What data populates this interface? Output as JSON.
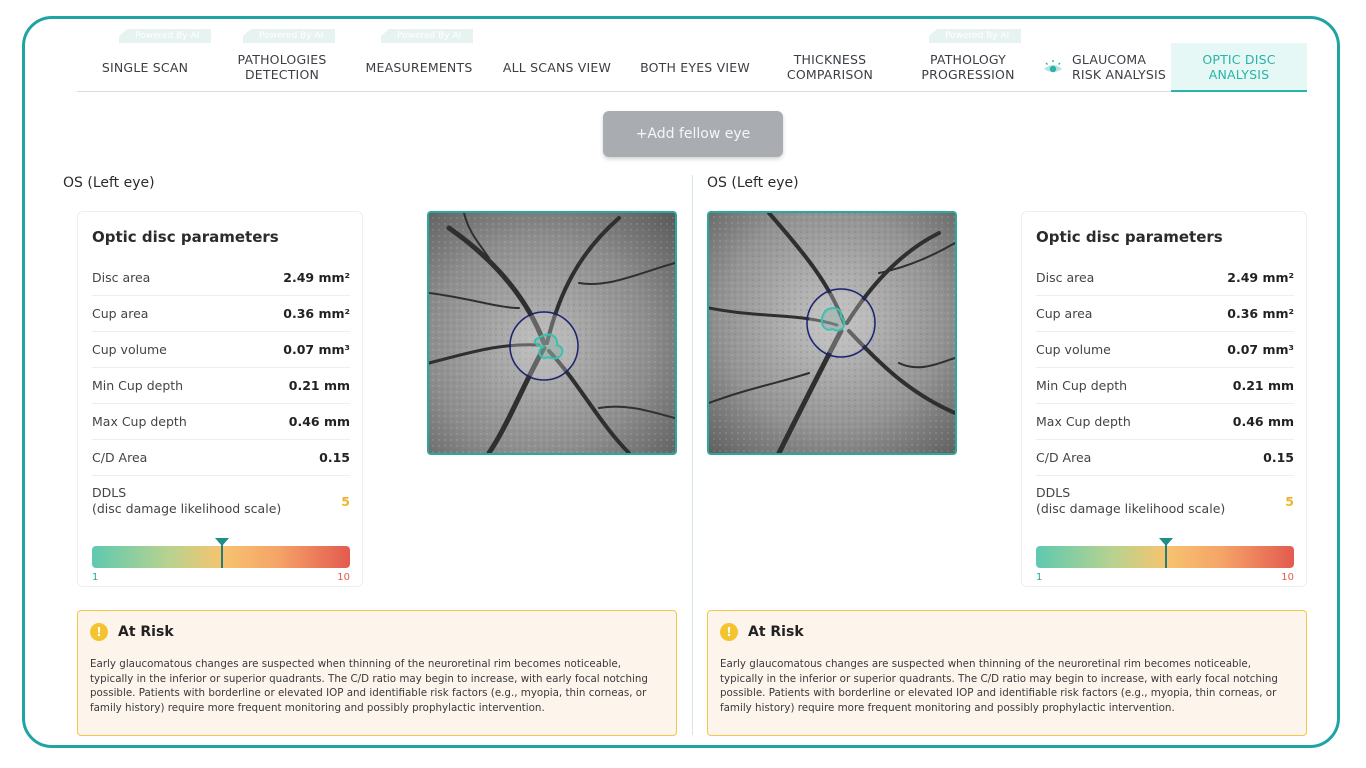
{
  "tabs": [
    {
      "label": "SINGLE SCAN",
      "badge": "Powered By AI",
      "active": false
    },
    {
      "label": "PATHOLOGIES DETECTION",
      "badge": "Powered By AI",
      "active": false
    },
    {
      "label": "MEASUREMENTS",
      "badge": "Powered By AI",
      "active": false
    },
    {
      "label": "ALL SCANS VIEW",
      "badge": "",
      "active": false
    },
    {
      "label": "BOTH EYES VIEW",
      "badge": "",
      "active": false
    },
    {
      "label": "THICKNESS COMPARISON",
      "badge": "",
      "active": false
    },
    {
      "label": "PATHOLOGY PROGRESSION",
      "badge": "Powered By AI",
      "active": false
    },
    {
      "label": "GLAUCOMA RISK ANALYSIS",
      "badge": "",
      "active": false,
      "icon": "eye-icon"
    },
    {
      "label": "OPTIC DISC ANALYSIS",
      "badge": "",
      "active": true
    }
  ],
  "add_fellow_eye": "+Add fellow eye",
  "panels": [
    {
      "eye_title": "OS (Left eye)",
      "params_title": "Optic disc parameters",
      "params": [
        {
          "label": "Disc area",
          "value": "2.49 mm²"
        },
        {
          "label": "Cup area",
          "value": "0.36 mm²"
        },
        {
          "label": "Cup volume",
          "value": "0.07 mm³"
        },
        {
          "label": "Min Cup depth",
          "value": "0.21 mm"
        },
        {
          "label": "Max Cup depth",
          "value": "0.46 mm"
        },
        {
          "label": "C/D Area",
          "value": "0.15"
        }
      ],
      "ddls_label_line1": "DDLS",
      "ddls_label_line2": "(disc damage likelihood scale)",
      "ddls_value": "5",
      "ddls_fraction": 0.5,
      "scale_min": "1",
      "scale_max": "10",
      "risk_title": "At Risk",
      "risk_text": "Early glaucomatous changes are suspected when thinning of the neuroretinal rim becomes noticeable, typically in the inferior or superior quadrants. The C/D ratio may begin to increase, with early focal notching possible. Patients with borderline or elevated IOP and identifiable risk factors (e.g., myopia, thin corneas, or family history) require more frequent monitoring and possibly prophylactic intervention."
    },
    {
      "eye_title": "OS (Left eye)",
      "params_title": "Optic disc parameters",
      "params": [
        {
          "label": "Disc area",
          "value": "2.49 mm²"
        },
        {
          "label": "Cup area",
          "value": "0.36 mm²"
        },
        {
          "label": "Cup volume",
          "value": "0.07 mm³"
        },
        {
          "label": "Min Cup depth",
          "value": "0.21 mm"
        },
        {
          "label": "Max Cup depth",
          "value": "0.46 mm"
        },
        {
          "label": "C/D Area",
          "value": "0.15"
        }
      ],
      "ddls_label_line1": "DDLS",
      "ddls_label_line2": "(disc damage likelihood scale)",
      "ddls_value": "5",
      "ddls_fraction": 0.5,
      "scale_min": "1",
      "scale_max": "10",
      "risk_title": "At Risk",
      "risk_text": "Early glaucomatous changes are suspected when thinning of the neuroretinal rim becomes noticeable, typically in the inferior or superior quadrants. The C/D ratio may begin to increase, with early focal notching possible. Patients with borderline or elevated IOP and identifiable risk factors (e.g., myopia, thin corneas, or family history) require more frequent monitoring and possibly prophylactic intervention."
    }
  ],
  "colors": {
    "accent": "#2ab3a6",
    "frame": "#1fa3a3",
    "warning": "#f3c64a",
    "ddls": "#f2b32b"
  }
}
